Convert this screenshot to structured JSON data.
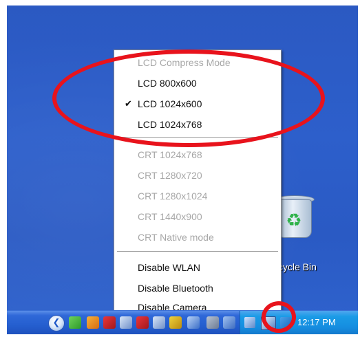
{
  "desktop": {
    "recycle_bin_label": "Recycle Bin"
  },
  "menu": {
    "items": [
      {
        "label": "LCD Compress Mode",
        "enabled": false,
        "checked": false
      },
      {
        "label": "LCD 800x600",
        "enabled": true,
        "checked": false
      },
      {
        "label": "LCD 1024x600",
        "enabled": true,
        "checked": true
      },
      {
        "label": "LCD 1024x768",
        "enabled": true,
        "checked": false
      },
      {
        "label": "CRT 1024x768",
        "enabled": false,
        "checked": false
      },
      {
        "label": "CRT 1280x720",
        "enabled": false,
        "checked": false
      },
      {
        "label": "CRT 1280x1024",
        "enabled": false,
        "checked": false
      },
      {
        "label": "CRT 1440x900",
        "enabled": false,
        "checked": false
      },
      {
        "label": "CRT Native mode",
        "enabled": false,
        "checked": false
      },
      {
        "label": "Disable WLAN",
        "enabled": true,
        "checked": false
      },
      {
        "label": "Disable Bluetooth",
        "enabled": true,
        "checked": false
      },
      {
        "label": "Disable Camera",
        "enabled": true,
        "checked": false
      }
    ],
    "check_glyph": "✔"
  },
  "taskbar": {
    "clock": "12:17 PM",
    "back_glyph": "❮"
  },
  "colors": {
    "annotation": "#e8131c",
    "taskbar": "#255fd0",
    "tray": "#158de0"
  }
}
